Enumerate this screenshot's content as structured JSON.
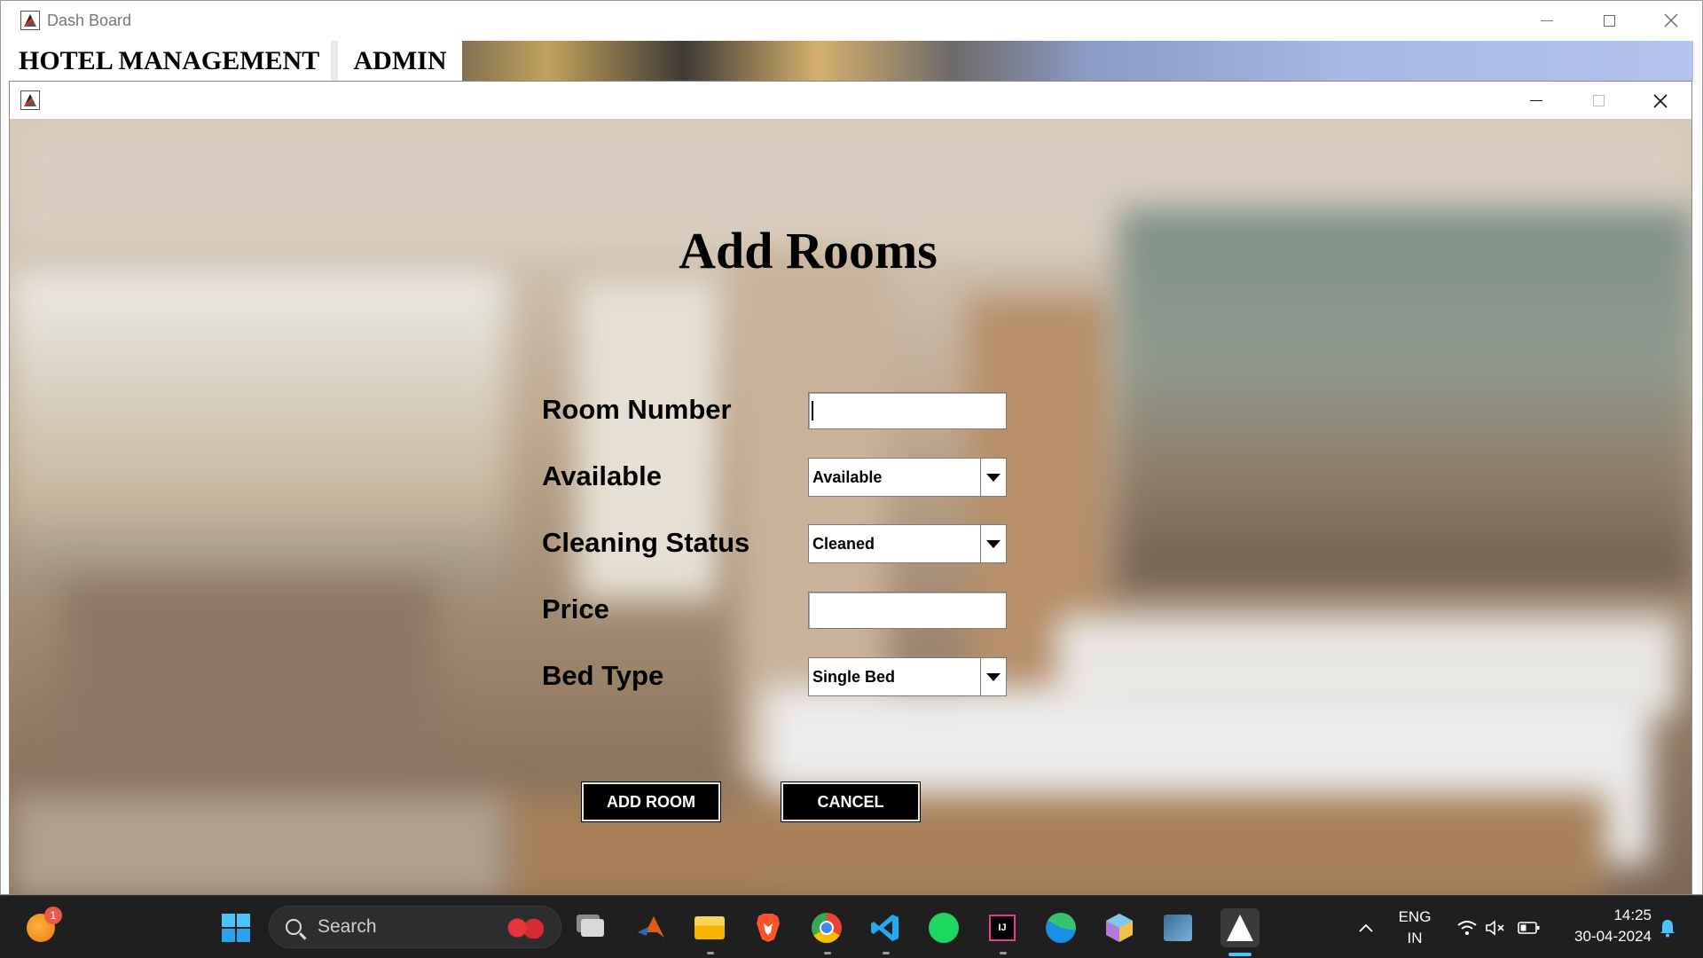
{
  "outer_window": {
    "title": "Dash Board",
    "minimize_icon": "minimize-icon",
    "maximize_icon": "maximize-icon",
    "close_icon": "close-icon"
  },
  "menu": {
    "items": [
      "HOTEL MANAGEMENT",
      "ADMIN"
    ]
  },
  "inner_window": {
    "icon": "java-app-icon",
    "minimize_icon": "minimize-icon",
    "maximize_icon": "maximize-icon",
    "close_icon": "close-icon"
  },
  "form": {
    "title": "Add Rooms",
    "labels": {
      "room_number": "Room Number",
      "available": "Available",
      "cleaning_status": "Cleaning Status",
      "price": "Price",
      "bed_type": "Bed Type"
    },
    "values": {
      "room_number": "",
      "available": "Available",
      "cleaning_status": "Cleaned",
      "price": "",
      "bed_type": "Single Bed"
    },
    "buttons": {
      "add_room": "ADD ROOM",
      "cancel": "CANCEL"
    }
  },
  "taskbar": {
    "notification_badge": "1",
    "search_placeholder": "Search",
    "language": "ENG",
    "region": "IN",
    "time": "14:25",
    "date": "30-04-2024",
    "icons": [
      "start-icon",
      "task-view-icon",
      "matlab-icon",
      "file-explorer-icon",
      "brave-icon",
      "chrome-icon",
      "vscode-icon",
      "spotify-icon",
      "intellij-icon",
      "edge-icon",
      "app-cube-icon",
      "mysql-workbench-icon",
      "java-app-icon"
    ],
    "tray_icons": [
      "chevron-up-icon",
      "wifi-icon",
      "speaker-muted-icon",
      "battery-icon",
      "bell-icon"
    ]
  },
  "colors": {
    "taskbar_bg": "#1f1f1f",
    "button_bg": "#000000",
    "button_text": "#ffffff"
  }
}
